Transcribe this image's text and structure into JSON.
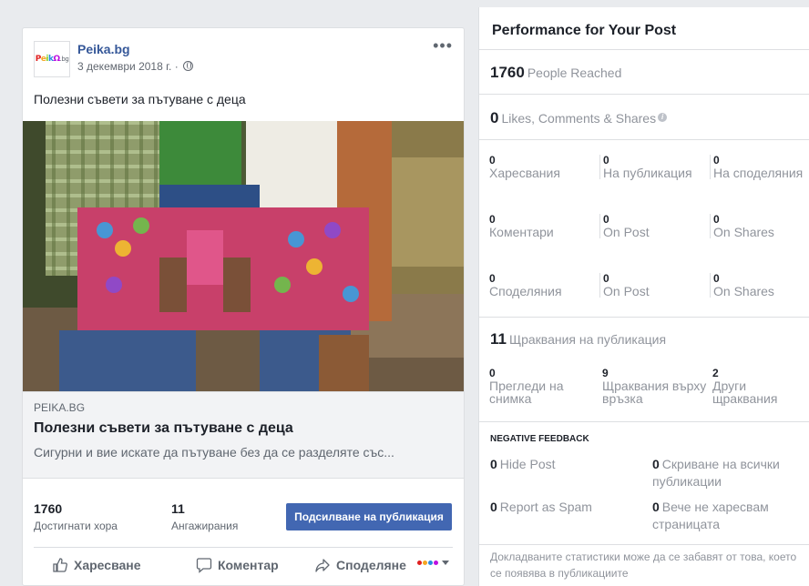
{
  "post": {
    "page_name": "Peika.bg",
    "avatar_text": "ΡeikΩ.bg",
    "date": "3 декември 2018 г. · ",
    "text": "Полезни съвети за пътуване с деца",
    "image_description_icon": "family-photo",
    "link": {
      "domain": "PEIKA.BG",
      "title": "Полезни съвети за пътуване с деца",
      "description": "Сигурни и вие искате да пътуване без да се разделяте със..."
    },
    "stats": {
      "reached_value": "1760",
      "reached_label": "Достигнати хора",
      "engagements_value": "11",
      "engagements_label": "Ангажирания"
    },
    "boost_label": "Подсилване на публикация",
    "actions": {
      "like": "Харесване",
      "comment": "Коментар",
      "share": "Споделяне"
    }
  },
  "insights": {
    "title": "Performance for Your Post",
    "people_reached_value": "1760",
    "people_reached_label": "People Reached",
    "lcs_value": "0",
    "lcs_label": "Likes, Comments & Shares",
    "rows": [
      {
        "a_val": "0",
        "a_lbl": "Харесвания",
        "b_val": "0",
        "b_lbl": "На публикация",
        "c_val": "0",
        "c_lbl": "На споделяния"
      },
      {
        "a_val": "0",
        "a_lbl": "Коментари",
        "b_val": "0",
        "b_lbl": "On Post",
        "c_val": "0",
        "c_lbl": "On Shares"
      },
      {
        "a_val": "0",
        "a_lbl": "Споделяния",
        "b_val": "0",
        "b_lbl": "On Post",
        "c_val": "0",
        "c_lbl": "On Shares"
      }
    ],
    "clicks_value": "11",
    "clicks_label": "Щраквания на публикация",
    "clicks_breakdown": [
      {
        "val": "0",
        "lbl": "Прегледи на снимка"
      },
      {
        "val": "9",
        "lbl": "Щраквания върху връзка"
      },
      {
        "val": "2",
        "lbl": "Други щраквания"
      }
    ],
    "negative_header": "NEGATIVE FEEDBACK",
    "negative": [
      {
        "val": "0",
        "lbl": "Hide Post"
      },
      {
        "val": "0",
        "lbl": "Скриване на всички публикации"
      },
      {
        "val": "0",
        "lbl": "Report as Spam"
      },
      {
        "val": "0",
        "lbl": "Вече не харесвам страницата"
      }
    ],
    "footnote": "Докладваните статистики може да се забавят от това, което се появява в публикациите"
  },
  "colors": {
    "brand_blue": "#4267b2",
    "link_blue": "#365899",
    "muted_text": "#90949c"
  }
}
